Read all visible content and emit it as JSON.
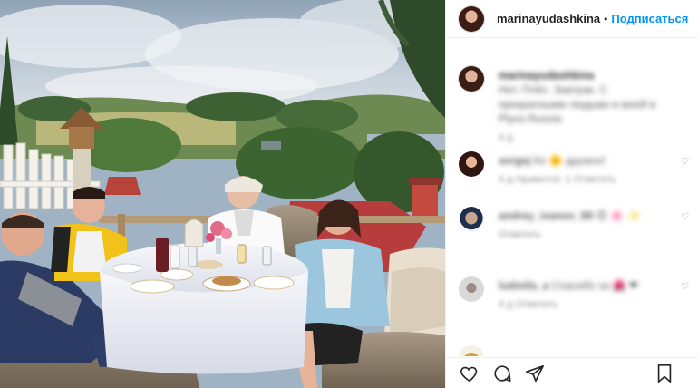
{
  "post": {
    "author": "marinayudashkina",
    "separator": "•",
    "follow_label": "Подписаться"
  },
  "comments": [
    {
      "author": "marinayudashkina",
      "text_lines": [
        "Нет. Плёс. Завтрак. С",
        "прекрасными людьми и моей в",
        "Plyos Russia"
      ],
      "meta": "4 д"
    },
    {
      "author": "sergej",
      "text_lines": [
        "Ко 🌞 дружно!"
      ],
      "meta": "4 д   Нравится: 1  Ответить"
    },
    {
      "author": "andrey_ivanov_89",
      "text_lines": [
        "😍 🌸 ✨"
      ],
      "meta": "Ответить"
    },
    {
      "author": "ludmila_a",
      "text_lines": [
        "Спасибо за 🌺 ❤"
      ],
      "meta": "4 д   Ответить"
    },
    {
      "author": "",
      "text_lines": [
        ""
      ],
      "meta": ""
    }
  ],
  "icons": {
    "like": "heart-icon",
    "comment": "comment-icon",
    "share": "share-icon",
    "save": "bookmark-icon"
  }
}
